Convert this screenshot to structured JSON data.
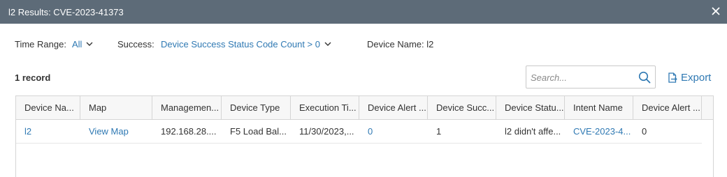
{
  "window": {
    "title": "l2 Results: CVE-2023-41373"
  },
  "filters": {
    "time_range_label": "Time Range:",
    "time_range_value": "All",
    "success_label": "Success:",
    "success_value": "Device Success Status Code Count > 0",
    "device_name_text": "Device Name: l2"
  },
  "records": {
    "count_text": "1 record"
  },
  "search": {
    "placeholder": "Search..."
  },
  "toolbar": {
    "export_label": "Export"
  },
  "table": {
    "columns": [
      "Device Na...",
      "Map",
      "Managemen...",
      "Device Type",
      "Execution Ti...",
      "Device Alert ...",
      "Device Succ...",
      "Device Statu...",
      "Intent Name",
      "Device Alert ..."
    ],
    "rows": [
      {
        "device_name": "l2",
        "map": "View Map",
        "management_ip": "192.168.28....",
        "device_type": "F5 Load Bal...",
        "execution_time": "11/30/2023,...",
        "device_alert_count": "0",
        "device_success_count": "1",
        "device_status": "l2 didn't affe...",
        "intent_name": "CVE-2023-4...",
        "device_alert_2": "0"
      }
    ]
  },
  "colors": {
    "titlebar_bg": "#5d6b78",
    "link": "#2f79b3",
    "header_bg": "#f7f7f7",
    "border": "#d5d5d5"
  },
  "icons": {
    "close": "close-icon",
    "search": "search-icon",
    "export": "export-icon",
    "dropdown": "chevron-down-icon"
  }
}
